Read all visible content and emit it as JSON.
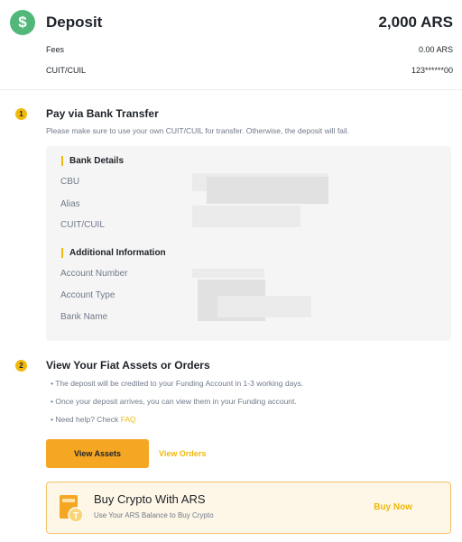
{
  "header": {
    "title": "Deposit",
    "amount": "2,000 ARS",
    "icon": "dollar-icon",
    "icon_color": "#52b87a",
    "rows": [
      {
        "label": "Fees",
        "value": "0.00 ARS"
      },
      {
        "label": "CUIT/CUIL",
        "value": "123******00"
      }
    ]
  },
  "step1": {
    "number": "1",
    "title": "Pay via Bank Transfer",
    "description": "Please make sure to use your own CUIT/CUIL for transfer. Otherwise, the deposit will fail.",
    "bank_details": {
      "heading": "Bank Details",
      "fields": [
        {
          "label": "CBU"
        },
        {
          "label": "Alias"
        },
        {
          "label": "CUIT/CUIL"
        }
      ]
    },
    "additional_info": {
      "heading": "Additional Information",
      "fields": [
        {
          "label": "Account Number"
        },
        {
          "label": "Account Type"
        },
        {
          "label": "Bank Name"
        }
      ]
    }
  },
  "step2": {
    "number": "2",
    "title": "View Your Fiat Assets or Orders",
    "bullets": [
      "The deposit will be credited to your Funding Account in 1-3 working days.",
      "Once your deposit arrives, you can view them in your Funding account.",
      "Need help? Check "
    ],
    "faq_link": "FAQ",
    "primary_button": "View Assets",
    "secondary_link": "View Orders"
  },
  "promo": {
    "title": "Buy Crypto With ARS",
    "subtitle": "Use Your ARS Balance to Buy Crypto",
    "button": "Buy Now",
    "icon": "wallet-coin-icon"
  },
  "colors": {
    "accent": "#f0b90b",
    "button": "#f5a623",
    "text": "#1e2329",
    "muted": "#707a8a"
  }
}
